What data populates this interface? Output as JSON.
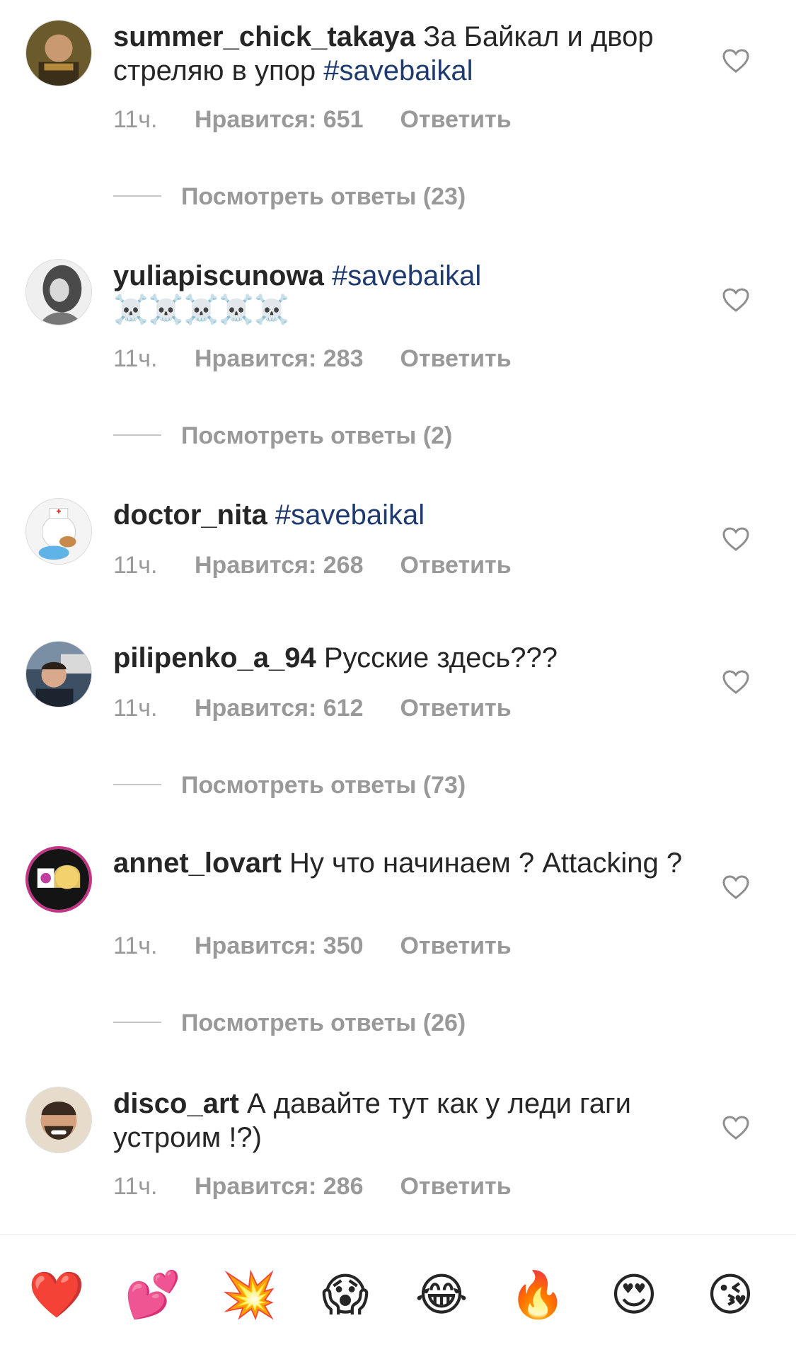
{
  "comments": [
    {
      "username": "summer_chick_takaya",
      "text": " За Байкал и двор стреляю в упор ",
      "hashtag": "#savebaikal",
      "time": "11ч.",
      "likes": "Нравится: 651",
      "reply": "Ответить",
      "view_replies": "Посмотреть ответы (23)"
    },
    {
      "username": "yuliapiscunowa",
      "text": " ",
      "hashtag": "#savebaikal",
      "emoji_line": "☠️☠️☠️☠️☠️",
      "time": "11ч.",
      "likes": "Нравится: 283",
      "reply": "Ответить",
      "view_replies": "Посмотреть ответы (2)"
    },
    {
      "username": "doctor_nita",
      "text": " ",
      "hashtag": "#savebaikal",
      "time": "11ч.",
      "likes": "Нравится: 268",
      "reply": "Ответить"
    },
    {
      "username": "pilipenko_a_94",
      "text": " Русские здесь???",
      "time": "11ч.",
      "likes": "Нравится: 612",
      "reply": "Ответить",
      "view_replies": "Посмотреть ответы (73)"
    },
    {
      "username": "annet_lovart",
      "text": " Ну что начинаем ? Attacking ?",
      "time": "11ч.",
      "likes": "Нравится: 350",
      "reply": "Ответить",
      "view_replies": "Посмотреть ответы (26)"
    },
    {
      "username": "disco_art",
      "text": " А давайте тут как у леди гаги устроим !?)",
      "time": "11ч.",
      "likes": "Нравится: 286",
      "reply": "Ответить"
    }
  ],
  "quick_reactions": [
    "❤️",
    "💕",
    "💥",
    "😱",
    "😂",
    "🔥",
    "😍",
    "😘"
  ],
  "icons": {
    "like": "heart-outline-icon"
  },
  "colors": {
    "hashtag": "#1e3a6e",
    "meta": "#999999",
    "text": "#262626"
  }
}
